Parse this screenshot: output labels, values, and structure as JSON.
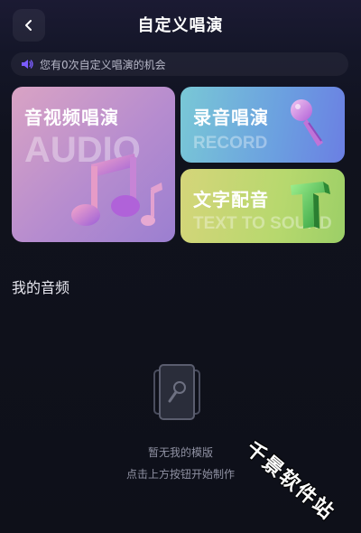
{
  "header": {
    "title": "自定义唱演",
    "back_icon": "chevron-left-icon"
  },
  "notice": {
    "icon": "speaker-icon",
    "text": "您有0次自定义唱演的机会"
  },
  "cards": {
    "audio": {
      "title": "音视频唱演",
      "subtitle": "AUDIO",
      "icon": "music-notes-icon"
    },
    "record": {
      "title": "录音唱演",
      "subtitle": "RECORD",
      "icon": "microphone-icon"
    },
    "text": {
      "title": "文字配音",
      "subtitle": "TEXT TO SOUND",
      "icon": "letter-t-icon"
    }
  },
  "section": {
    "title": "我的音频"
  },
  "empty": {
    "icon": "template-mic-icon",
    "line1": "暂无我的模版",
    "line2": "点击上方按钮开始制作"
  },
  "watermark": "千景软件站",
  "colors": {
    "background": "#10121d",
    "audio_card": "#c598cb",
    "record_card": "#6fa6de",
    "text_card": "#c6d674",
    "accent_purple": "#7b5cff"
  }
}
